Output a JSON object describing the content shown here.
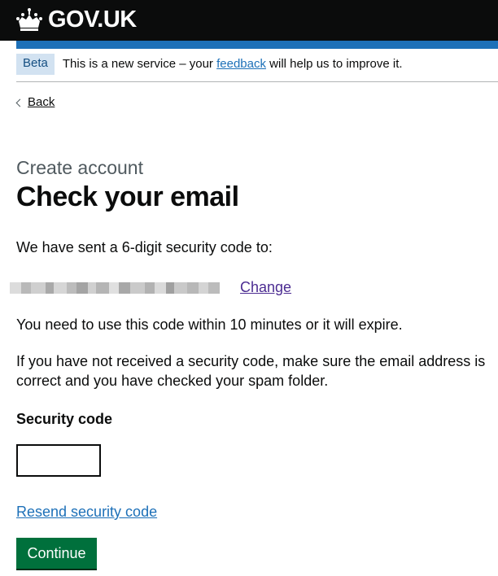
{
  "header": {
    "logo_text": "GOV.UK",
    "logo_icon": "crown-icon"
  },
  "phase_banner": {
    "tag": "Beta",
    "text_before": "This is a new service – your ",
    "link": "feedback",
    "text_after": " will help us to improve it."
  },
  "back_link": {
    "label": "Back",
    "icon": "chevron-left-icon"
  },
  "page": {
    "caption": "Create account",
    "title": "Check your email",
    "sent_text": "We have sent a 6-digit security code to:",
    "change_link": "Change",
    "expiry_text": "You need to use this code within 10 minutes or it will expire.",
    "help_text": "If you have not received a security code, make sure the email address is correct and you have checked your spam folder."
  },
  "form": {
    "code_label": "Security code",
    "code_value": "",
    "resend_link": "Resend security code",
    "continue_label": "Continue"
  },
  "colors": {
    "header_bg": "#0b0c0c",
    "brand_blue": "#1d70b8",
    "tag_bg": "#d2e2f1",
    "button_green": "#00703c",
    "visited_link": "#4c2c92"
  }
}
